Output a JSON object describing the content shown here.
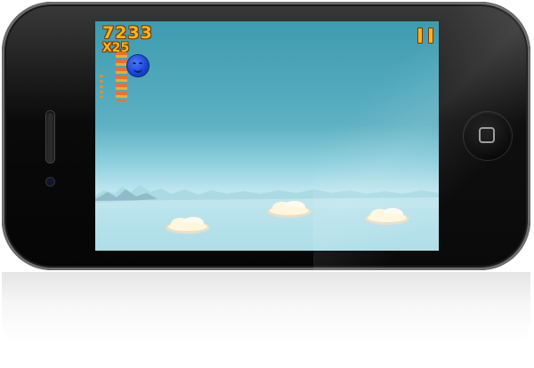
{
  "game": {
    "score": "7233",
    "combo": "X25"
  },
  "colors": {
    "hud_text": "#ffb21a",
    "hud_outline": "#7a3a00",
    "player_ball": "#1b46d8",
    "sky_top": "#3d9bb0",
    "sky_bottom": "#bfe6ef",
    "cloud": "#fff7dd",
    "device_body": "#0a0a0a"
  },
  "icons": {
    "pause": "pause-icon",
    "home": "home-button-icon"
  },
  "platforms": [
    "cloud-platform-1",
    "cloud-platform-2",
    "cloud-platform-3"
  ]
}
